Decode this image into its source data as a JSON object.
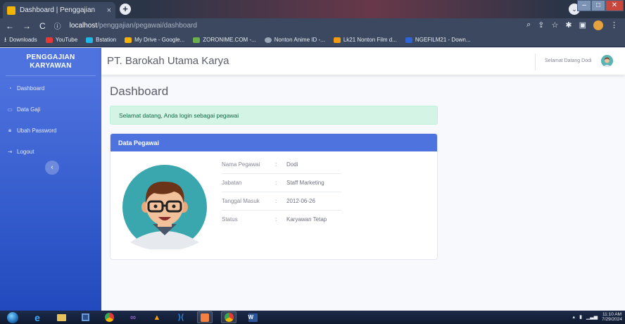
{
  "browser": {
    "tab_title": "Dashboard | Penggajian",
    "tab_close": "×",
    "new_tab": "+",
    "url_host": "localhost",
    "url_path": "/penggajian/pegawai/dashboard",
    "bookmarks": [
      {
        "label": "Downloads",
        "color": "#e8ecf2"
      },
      {
        "label": "YouTube",
        "color": "#e53935"
      },
      {
        "label": "Bstation",
        "color": "#21b6e6"
      },
      {
        "label": "My Drive - Google...",
        "color": "#f4b400"
      },
      {
        "label": "ZORONIME.COM -...",
        "color": "#6ab04c"
      },
      {
        "label": "Nonton Anime ID -...",
        "color": "#9aa7b8"
      },
      {
        "label": "Lk21 Nonton Film d...",
        "color": "#f39c12"
      },
      {
        "label": "NGEFILM21 - Down...",
        "color": "#2f64d8"
      }
    ]
  },
  "sidebar": {
    "brand": "PENGGAJIAN KARYAWAN",
    "items": [
      {
        "label": "Dashboard",
        "icon": "tachometer-icon"
      },
      {
        "label": "Data Gaji",
        "icon": "money-icon"
      },
      {
        "label": "Ubah Password",
        "icon": "lock-icon"
      },
      {
        "label": "Logout",
        "icon": "sign-out-icon"
      }
    ]
  },
  "topbar": {
    "company": "PT. Barokah Utama Karya",
    "welcome": "Selamat Datang Dodi"
  },
  "main": {
    "title": "Dashboard",
    "alert": "Selamat datang, Anda login sebagai pegawai",
    "card_title": "Data Pegawai",
    "rows": [
      {
        "label": "Nama Pegawai",
        "sep": ":",
        "value": "Dodi"
      },
      {
        "label": "Jabatan",
        "sep": ":",
        "value": "Staff Marketing"
      },
      {
        "label": "Tanggal Masuk",
        "sep": ":",
        "value": "2012-06-26"
      },
      {
        "label": "Status",
        "sep": ":",
        "value": "Karyawan Tetap"
      }
    ]
  },
  "taskbar": {
    "time": "11:10 AM",
    "date": "7/29/2024"
  },
  "colors": {
    "primary": "#4e73df",
    "alert_bg": "#d4f4e5",
    "alert_text": "#0f6848"
  }
}
